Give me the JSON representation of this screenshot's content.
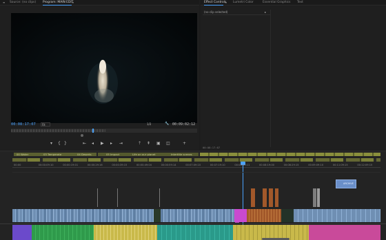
{
  "source_panel": {
    "tab_label": "Source: (no clips)"
  },
  "program_panel": {
    "tab_label": "Program: MAIN EDIT",
    "timecode_left": "00:08:17:07",
    "fit_label": "Fit",
    "fraction_label": "1/2",
    "timecode_right": "00:09:02:12"
  },
  "right_panel": {
    "tabs": [
      "Effect Controls",
      "Lumetri Color",
      "Essential Graphics",
      "Text"
    ],
    "no_clip_label": "(no clip selected)",
    "bottom_timecode": "00:08:17:07"
  },
  "timeline": {
    "markers": [
      "00 Water",
      "03 Temperate",
      "04 Deserts",
      "05 Impact",
      "Life on our planet",
      "Intertitle scenes"
    ],
    "ruler_times": [
      "00:00",
      "00:00:09:10",
      "00:00:19:01",
      "00:00:29:16",
      "00:00:39:15",
      "00:00:49:04",
      "00:00:59:14",
      "00:07:09:10",
      "00:07:19:10",
      "00:08:09:11",
      "00:08:19:00",
      "00:08:29:15",
      "00:09:09:10",
      "00:11:09:15",
      "00:12:09:15"
    ],
    "title_clip_label": "ARCHIVE"
  },
  "colors": {
    "accent_blue": "#4aa3ff",
    "video_clip_blue": "#6f8fb3",
    "audio_green": "#2f9a4b",
    "audio_yellow": "#c9b94a",
    "audio_pink": "#c94a9a",
    "marker_olive": "#8a8f3c",
    "clip_orange": "#a2582a"
  }
}
